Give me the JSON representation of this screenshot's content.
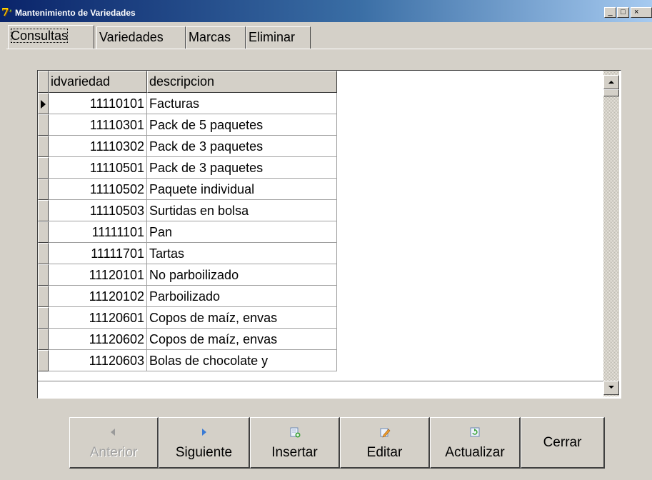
{
  "window": {
    "title": "Mantenimiento de Variedades",
    "controls": {
      "minimize": "_",
      "maximize": "□",
      "close": "×"
    }
  },
  "tabs": [
    {
      "label": "Consultas",
      "active": true
    },
    {
      "label": "Variedades",
      "active": false
    },
    {
      "label": "Marcas",
      "active": false
    },
    {
      "label": "Eliminar",
      "active": false
    }
  ],
  "grid": {
    "columns": [
      "idvariedad",
      "descripcion"
    ],
    "current_row": 0,
    "rows": [
      {
        "id": "11110101",
        "desc": "Facturas"
      },
      {
        "id": "11110301",
        "desc": "Pack de 5 paquetes"
      },
      {
        "id": "11110302",
        "desc": "Pack de 3 paquetes"
      },
      {
        "id": "11110501",
        "desc": "Pack de 3 paquetes"
      },
      {
        "id": "11110502",
        "desc": "Paquete individual"
      },
      {
        "id": "11110503",
        "desc": "Surtidas en bolsa"
      },
      {
        "id": "11111101",
        "desc": "Pan"
      },
      {
        "id": "11111701",
        "desc": "Tartas"
      },
      {
        "id": "11120101",
        "desc": "No parboilizado"
      },
      {
        "id": "11120102",
        "desc": "Parboilizado"
      },
      {
        "id": "11120601",
        "desc": "Copos de maíz, envas"
      },
      {
        "id": "11120602",
        "desc": "Copos de maíz, envas"
      },
      {
        "id": "11120603",
        "desc": "Bolas de chocolate y"
      }
    ]
  },
  "buttons": {
    "anterior": "Anterior",
    "siguiente": "Siguiente",
    "insertar": "Insertar",
    "editar": "Editar",
    "actualizar": "Actualizar",
    "cerrar": "Cerrar"
  },
  "colors": {
    "titlebar_start": "#0a246a",
    "titlebar_end": "#a6caf0",
    "face": "#d4d0c8",
    "nav_arrow": "#3a7bd5"
  },
  "icons": {
    "app": "app-logo-icon",
    "anterior": "arrow-left-icon",
    "siguiente": "arrow-right-icon",
    "insertar": "insert-record-icon",
    "editar": "edit-record-icon",
    "actualizar": "refresh-icon"
  }
}
